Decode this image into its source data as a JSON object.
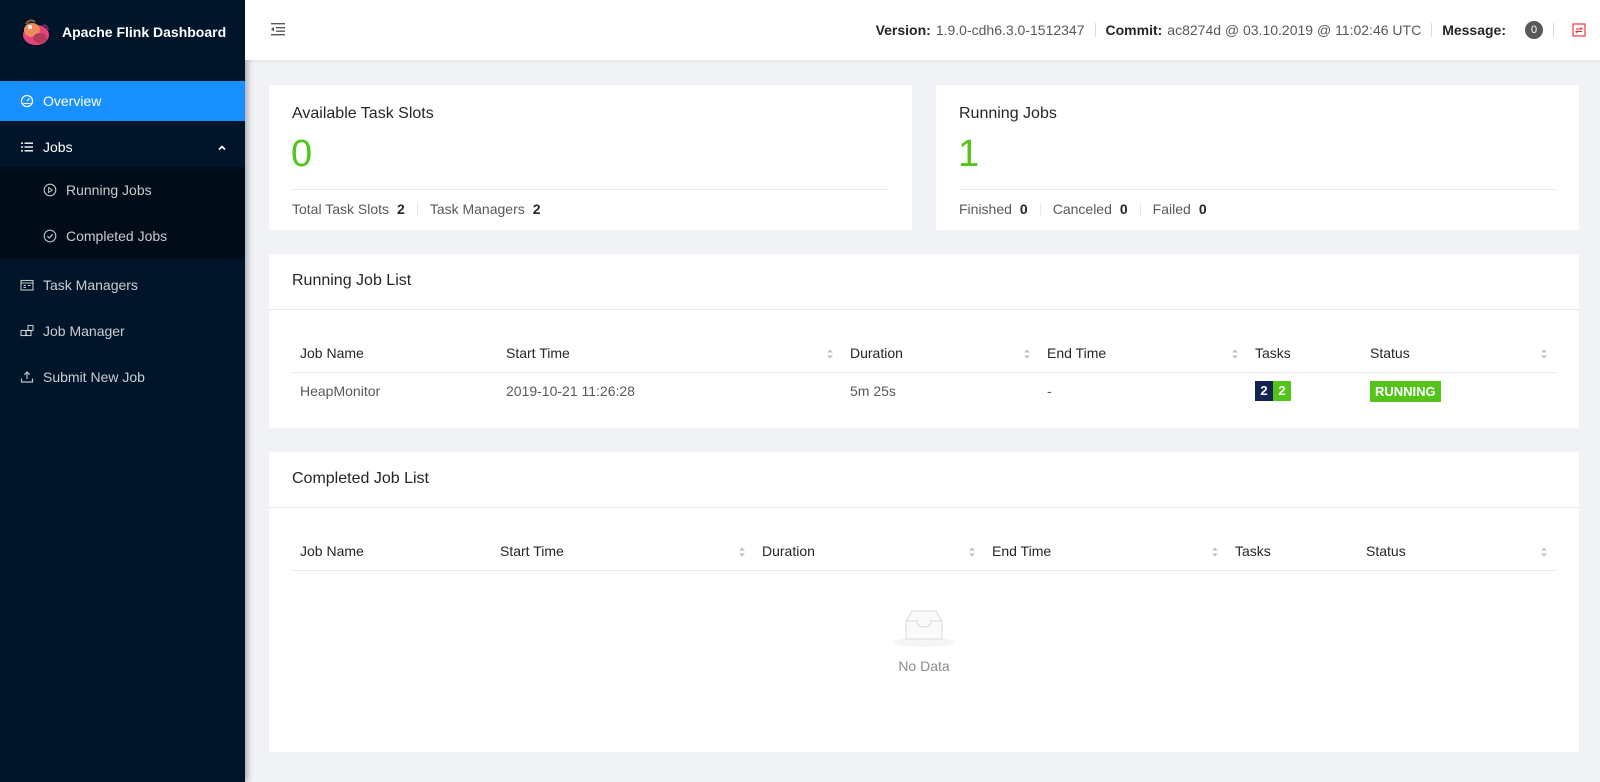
{
  "app": {
    "title": "Apache Flink Dashboard"
  },
  "sidebar": {
    "items": [
      {
        "label": "Overview",
        "icon": "dashboard-icon",
        "active": true
      },
      {
        "label": "Jobs",
        "icon": "unordered-list-icon",
        "expanded": true
      },
      {
        "label": "Running Jobs",
        "icon": "play-circle-icon"
      },
      {
        "label": "Completed Jobs",
        "icon": "check-circle-icon"
      },
      {
        "label": "Task Managers",
        "icon": "schedule-icon"
      },
      {
        "label": "Job Manager",
        "icon": "build-icon"
      },
      {
        "label": "Submit New Job",
        "icon": "upload-icon"
      }
    ]
  },
  "header": {
    "version_label": "Version:",
    "version_value": "1.9.0-cdh6.3.0-1512347",
    "commit_label": "Commit:",
    "commit_value": "ac8274d @ 03.10.2019 @ 11:02:46 UTC",
    "message_label": "Message:",
    "message_count": "0"
  },
  "task_slots": {
    "title": "Available Task Slots",
    "value": "0",
    "total_label": "Total Task Slots",
    "total_value": "2",
    "tm_label": "Task Managers",
    "tm_value": "2"
  },
  "running_jobs": {
    "title": "Running Jobs",
    "value": "1",
    "finished_label": "Finished",
    "finished_value": "0",
    "canceled_label": "Canceled",
    "canceled_value": "0",
    "failed_label": "Failed",
    "failed_value": "0"
  },
  "running_list": {
    "title": "Running Job List",
    "columns": [
      "Job Name",
      "Start Time",
      "Duration",
      "End Time",
      "Tasks",
      "Status"
    ],
    "rows": [
      {
        "job_name": "HeapMonitor",
        "start_time": "2019-10-21 11:26:28",
        "duration": "5m 25s",
        "end_time": "-",
        "tasks_total": "2",
        "tasks_running": "2",
        "status": "RUNNING"
      }
    ]
  },
  "completed_list": {
    "title": "Completed Job List",
    "columns": [
      "Job Name",
      "Start Time",
      "Duration",
      "End Time",
      "Tasks",
      "Status"
    ],
    "empty_text": "No Data"
  },
  "colors": {
    "sidebar_bg": "#001529",
    "accent": "#1890ff",
    "success": "#52c41a"
  }
}
